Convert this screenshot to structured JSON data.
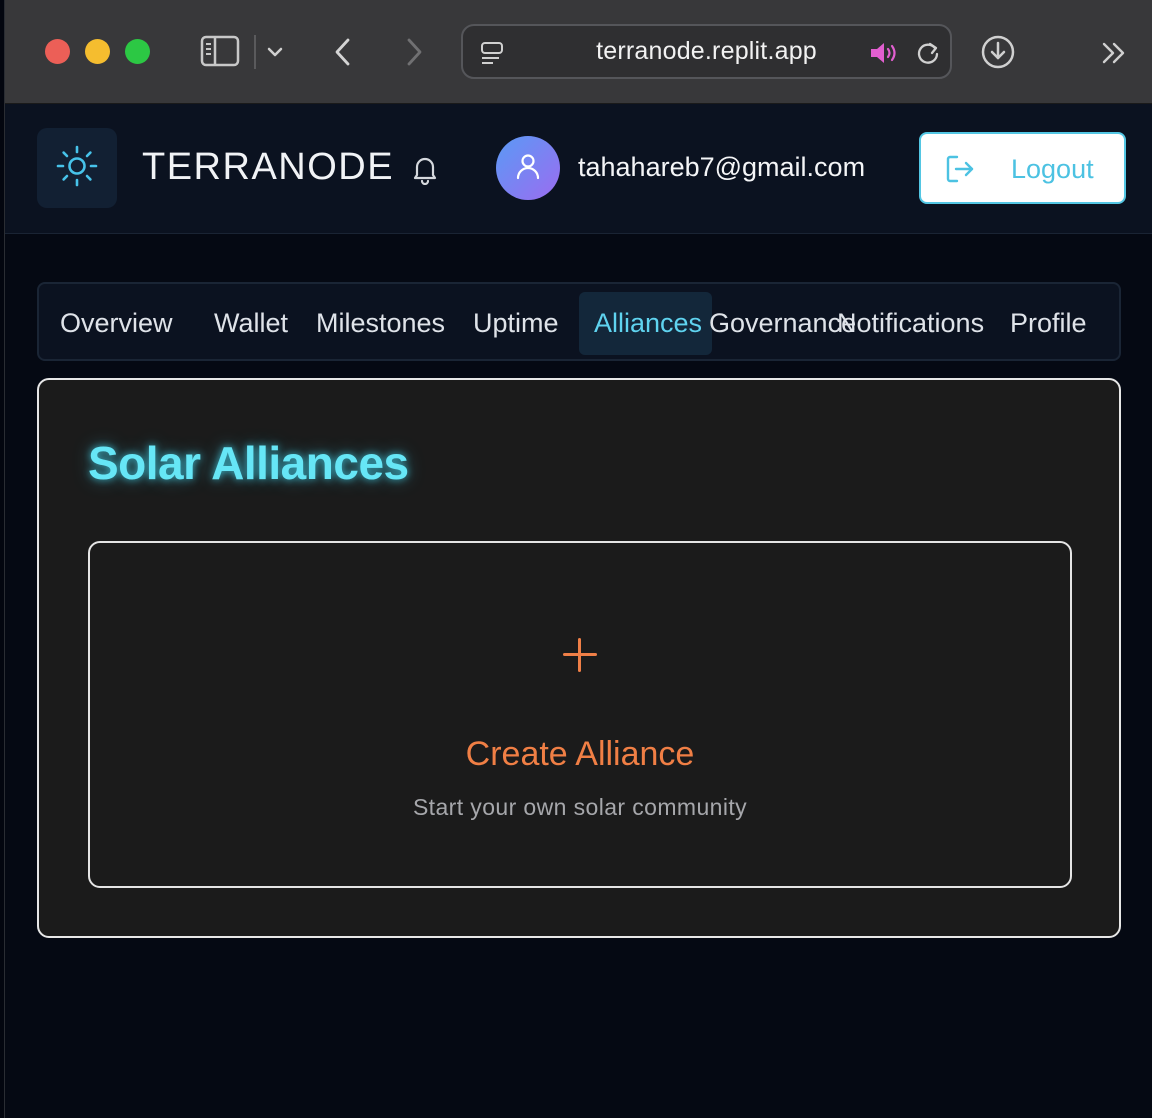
{
  "browser": {
    "url": "terranode.replit.app",
    "colors": {
      "close": "#ec5f57",
      "minimize": "#f5bd2f",
      "maximize": "#2cc844",
      "audio": "#e25fd0"
    }
  },
  "header": {
    "brand": "TERRANODE",
    "user_email": "tahahareb7@gmail.com",
    "logout_label": "Logout"
  },
  "tabs": [
    {
      "label": "Overview"
    },
    {
      "label": "Wallet"
    },
    {
      "label": "Milestones"
    },
    {
      "label": "Uptime"
    },
    {
      "label": "Alliances",
      "active": true
    },
    {
      "label": "Governance"
    },
    {
      "label": "Notifications"
    },
    {
      "label": "Profile"
    }
  ],
  "main": {
    "title": "Solar Alliances",
    "create_card": {
      "title": "Create Alliance",
      "subtitle": "Start your own solar community"
    }
  },
  "theme": {
    "accent_cyan": "#5fd3ef",
    "accent_orange": "#f07f45"
  }
}
